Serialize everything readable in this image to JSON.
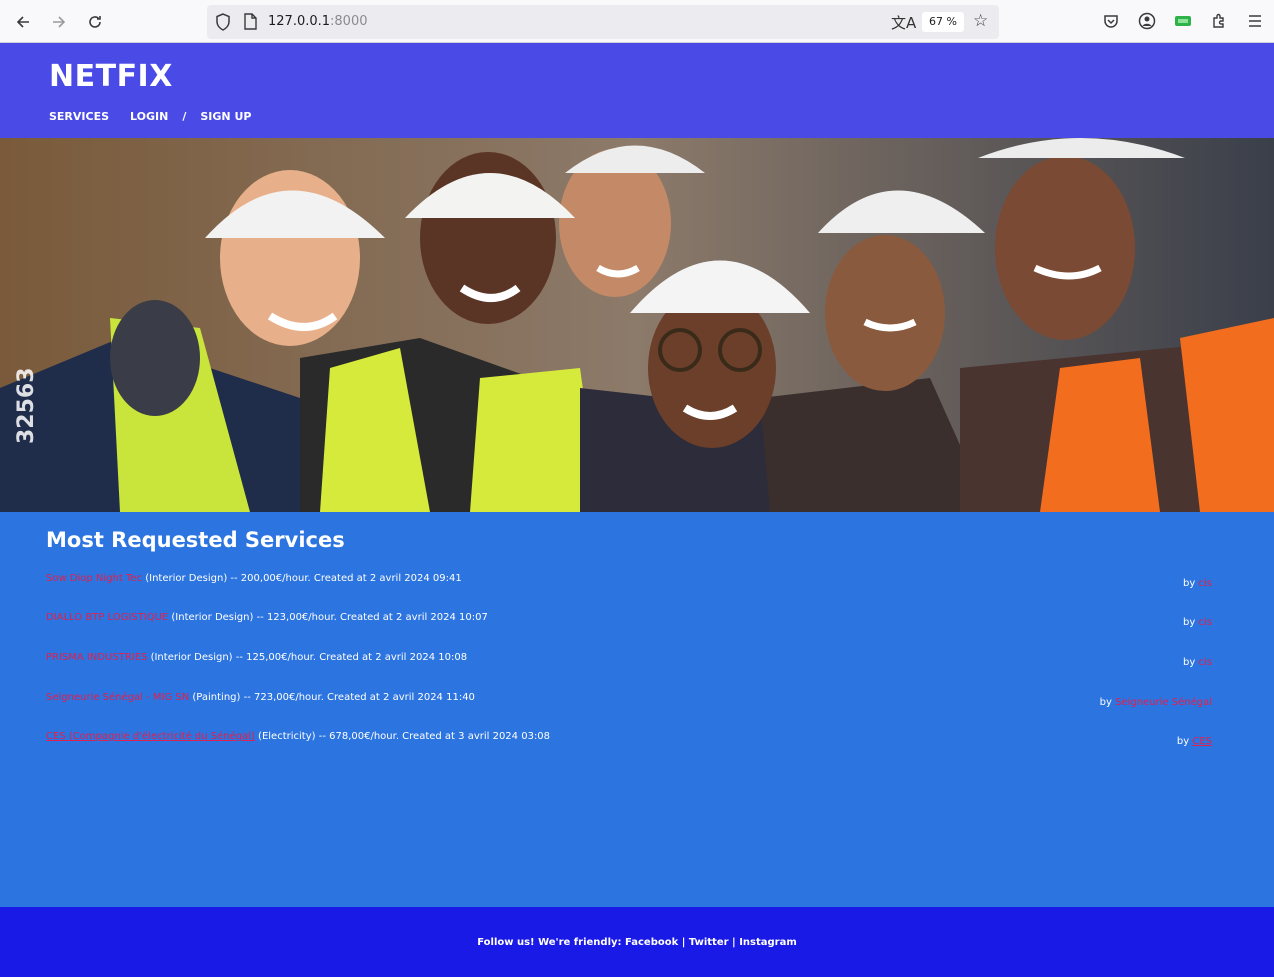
{
  "browser": {
    "url_host": "127.0.0.1",
    "url_port": ":8000",
    "zoom": "67 %"
  },
  "site": {
    "brand": "NETFIX",
    "nav": {
      "services": "SERVICES",
      "login": "LOGIN",
      "separator": "/",
      "signup": "SIGN UP"
    }
  },
  "hero": {
    "watermark": "32563"
  },
  "services": {
    "title": "Most Requested Services",
    "items": [
      {
        "name": "Sow Diop Night Tec",
        "details": " (Interior Design) -- 200,00€/hour. Created at 2 avril 2024 09:41",
        "by": "by ",
        "author": "cis"
      },
      {
        "name": "DIALLO BTP LOGISTIQUE",
        "details": " (Interior Design) -- 123,00€/hour. Created at 2 avril 2024 10:07",
        "by": "by ",
        "author": "cis"
      },
      {
        "name": "PRISMA INDUSTRIES",
        "details": " (Interior Design) -- 125,00€/hour. Created at 2 avril 2024 10:08",
        "by": "by ",
        "author": "cis"
      },
      {
        "name": "Seigneurie Sénégal - MIG SN",
        "details": " (Painting) -- 723,00€/hour. Created at 2 avril 2024 11:40",
        "by": "by ",
        "author": "Seigneurie Sénégal"
      },
      {
        "name": "CES (Compagnie d'électricité du Sénégal)",
        "details": " (Electricity) -- 678,00€/hour. Created at 3 avril 2024 03:08",
        "by": "by ",
        "author": "CES"
      }
    ]
  },
  "footer": {
    "prefix": "Follow us! We're friendly: ",
    "facebook": "Facebook",
    "sep1": " | ",
    "twitter": "Twitter",
    "sep2": " | ",
    "instagram": "Instagram"
  },
  "colors": {
    "header_bg": "#4a4ae6",
    "body_bg": "#2c74df",
    "footer_bg": "#1a1ae6",
    "link_red": "#e0204e"
  }
}
